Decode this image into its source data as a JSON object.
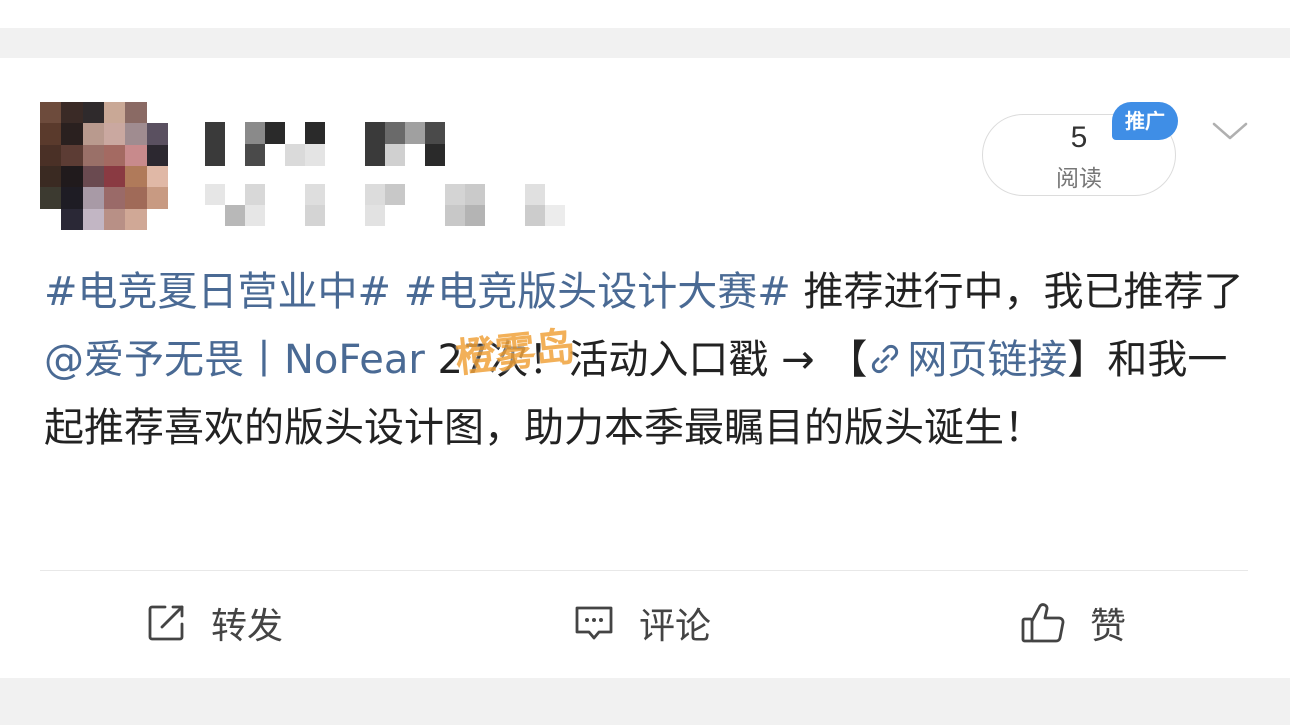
{
  "post": {
    "read_count": "5",
    "read_label": "阅读",
    "promo_badge": "推广",
    "segments": {
      "hashtag1": "#电竞夏日营业中#",
      "hashtag2": "#电竞版头设计大赛#",
      "text1": " 推荐进行中，我已推荐了",
      "mention": "@爱予无畏丨NoFear",
      "text2": " 27次！活动入口戳 → ",
      "bracket_open": "【",
      "link_label": "网页链接",
      "bracket_close": "】",
      "text3": "和我一起推荐喜欢的版头设计图，助力本季最瞩目的版头诞生！"
    },
    "watermark": "橙雾岛"
  },
  "actions": {
    "repost": "转发",
    "comment": "评论",
    "like": "赞"
  },
  "icons": {
    "repost": "repost-icon",
    "comment": "comment-icon",
    "like": "thumbs-up-icon",
    "link": "link-icon",
    "chevron": "chevron-down-icon"
  },
  "colors": {
    "link": "#4a6a94",
    "badge": "#3f8ee6"
  }
}
